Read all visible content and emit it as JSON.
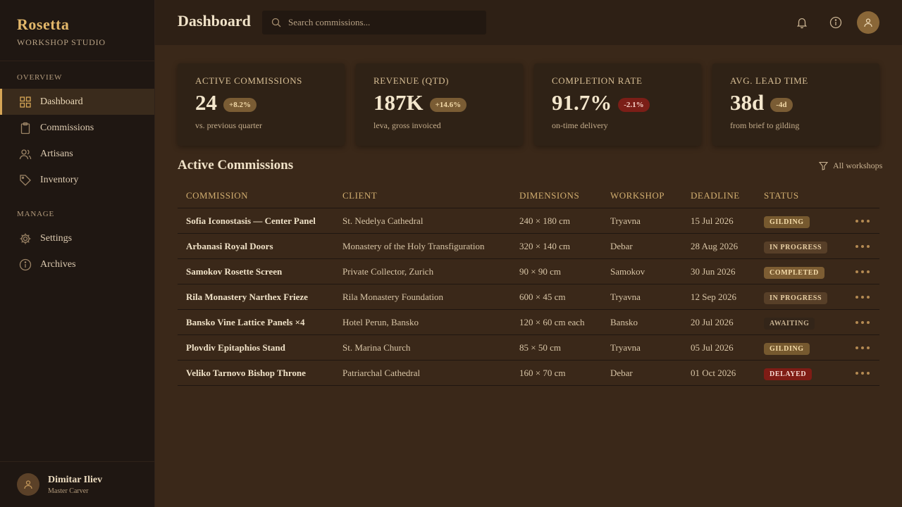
{
  "brand": {
    "name": "Rosetta",
    "subtitle": "WORKSHOP STUDIO"
  },
  "sidebar": {
    "sections": [
      {
        "label": "OVERVIEW",
        "items": [
          {
            "label": "Dashboard",
            "icon": "grid-icon",
            "active": true
          },
          {
            "label": "Commissions",
            "icon": "clipboard-icon"
          },
          {
            "label": "Artisans",
            "icon": "users-icon"
          },
          {
            "label": "Inventory",
            "icon": "tag-icon"
          }
        ]
      },
      {
        "label": "MANAGE",
        "items": [
          {
            "label": "Settings",
            "icon": "gear-icon"
          },
          {
            "label": "Archives",
            "icon": "info-circle-icon"
          }
        ]
      }
    ]
  },
  "user": {
    "name": "Dimitar Iliev",
    "role": "Master Carver"
  },
  "header": {
    "title": "Dashboard"
  },
  "search": {
    "placeholder": "Search commissions...",
    "value": ""
  },
  "stats": [
    {
      "label": "ACTIVE COMMISSIONS",
      "value": "24",
      "delta": "+8.2%",
      "trend": "pos",
      "note": "vs. previous quarter"
    },
    {
      "label": "REVENUE (QTD)",
      "value": "187K",
      "delta": "+14.6%",
      "trend": "pos",
      "note": "leva, gross invoiced"
    },
    {
      "label": "COMPLETION RATE",
      "value": "91.7%",
      "delta": "-2.1%",
      "trend": "neg",
      "note": "on-time delivery"
    },
    {
      "label": "AVG. LEAD TIME",
      "value": "38d",
      "delta": "-4d",
      "trend": "pos",
      "note": "from brief to gilding"
    }
  ],
  "section": {
    "title": "Active Commissions",
    "filter": "All workshops"
  },
  "table": {
    "columns": [
      "COMMISSION",
      "CLIENT",
      "DIMENSIONS",
      "WORKSHOP",
      "DEADLINE",
      "STATUS"
    ],
    "rows": [
      {
        "commission": "Sofia Iconostasis — Center Panel",
        "client": "St. Nedelya Cathedral",
        "dimensions": "240 × 180 cm",
        "workshop": "Tryavna",
        "deadline": "15 Jul 2026",
        "status": "GILDING",
        "status_class": "gilding"
      },
      {
        "commission": "Arbanasi Royal Doors",
        "client": "Monastery of the Holy Transfiguration",
        "dimensions": "320 × 140 cm",
        "workshop": "Debar",
        "deadline": "28 Aug 2026",
        "status": "IN PROGRESS",
        "status_class": "inprogress"
      },
      {
        "commission": "Samokov Rosette Screen",
        "client": "Private Collector, Zurich",
        "dimensions": "90 × 90 cm",
        "workshop": "Samokov",
        "deadline": "30 Jun 2026",
        "status": "COMPLETED",
        "status_class": "completed"
      },
      {
        "commission": "Rila Monastery Narthex Frieze",
        "client": "Rila Monastery Foundation",
        "dimensions": "600 × 45 cm",
        "workshop": "Tryavna",
        "deadline": "12 Sep 2026",
        "status": "IN PROGRESS",
        "status_class": "inprogress"
      },
      {
        "commission": "Bansko Vine Lattice Panels ×4",
        "client": "Hotel Perun, Bansko",
        "dimensions": "120 × 60 cm each",
        "workshop": "Bansko",
        "deadline": "20 Jul 2026",
        "status": "AWAITING",
        "status_class": "awaiting"
      },
      {
        "commission": "Plovdiv Epitaphios Stand",
        "client": "St. Marina Church",
        "dimensions": "85 × 50 cm",
        "workshop": "Tryavna",
        "deadline": "05 Jul 2026",
        "status": "GILDING",
        "status_class": "gilding"
      },
      {
        "commission": "Veliko Tarnovo Bishop Throne",
        "client": "Patriarchal Cathedral",
        "dimensions": "160 × 70 cm",
        "workshop": "Debar",
        "deadline": "01 Oct 2026",
        "status": "DELAYED",
        "status_class": "delayed"
      }
    ]
  },
  "colors": {
    "accent": "#d6a656",
    "background": "#3a2819",
    "sidebar": "#1f1712",
    "danger": "#7f1c15"
  }
}
